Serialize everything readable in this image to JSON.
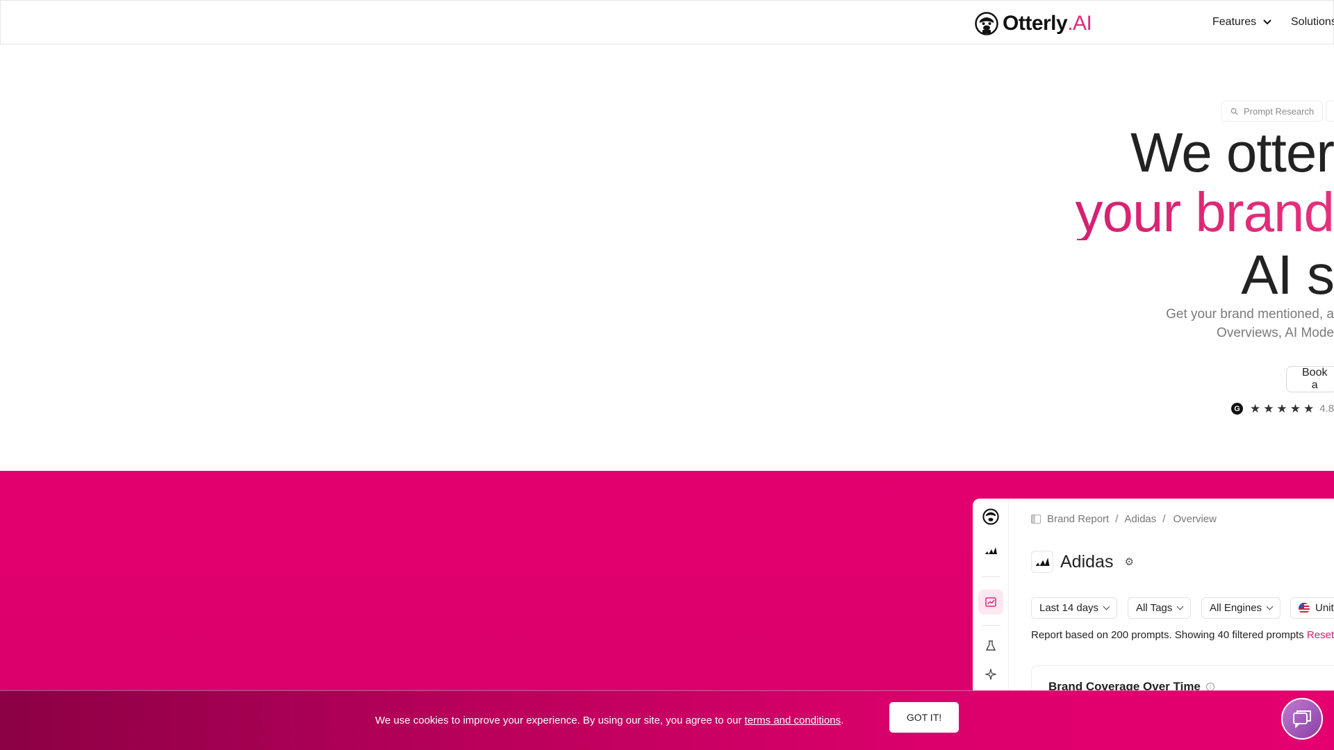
{
  "nav": {
    "logo_text": "Otterly",
    "logo_suffix": ".AI",
    "features_label": "Features",
    "solutions_label": "Solutions"
  },
  "hero": {
    "chip_search_label": "Prompt Research",
    "headline_line1": "We otter",
    "headline_line2": "your brand",
    "headline_line3": "AI s",
    "sub_line1": "Get your brand mentioned, a",
    "sub_line2": "Overviews, AI Mode",
    "book_label": "Book a",
    "rating_value": "4.8",
    "review_badge": "G",
    "star_count": 5
  },
  "app": {
    "breadcrumb": [
      "Brand Report",
      "/",
      "Adidas",
      "/",
      "Overview"
    ],
    "brand_name": "Adidas",
    "filters": {
      "period": "Last 14 days",
      "tags": "All Tags",
      "engines": "All Engines",
      "country": "Unit"
    },
    "report_text": "Report based on 200 prompts. Showing 40 filtered prompts",
    "reset_label": "Reset",
    "card_title": "Brand Coverage Over Time"
  },
  "cookie": {
    "text_before": "We use cookies to improve your experience. By using our site, you agree to our",
    "terms_label": "terms and conditions",
    "text_after": ".",
    "button_label": "GOT IT!"
  },
  "colors": {
    "brand_pink": "#e2006f",
    "accent_text": "#d61f72",
    "cookie_dark": "#8c0045"
  }
}
